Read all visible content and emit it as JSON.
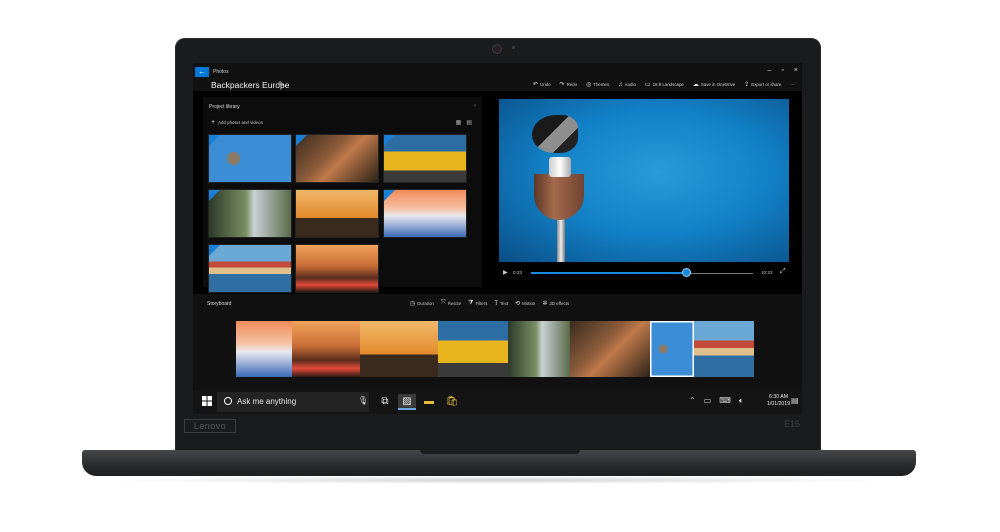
{
  "hardware": {
    "brand": "Lenovo",
    "model": "E15"
  },
  "app": {
    "name": "Photos",
    "project_title": "Backpackers Europe",
    "back_icon": "back-arrow-icon",
    "window_controls": [
      "–",
      "▫",
      "×"
    ]
  },
  "toolbar": {
    "items": [
      {
        "label": "Undo",
        "icon": "↶"
      },
      {
        "label": "Redo",
        "icon": "↷"
      },
      {
        "label": "Themes",
        "icon": "◎"
      },
      {
        "label": "Audio",
        "icon": "♫"
      },
      {
        "label": "16:9 Landscape",
        "icon": "▭"
      },
      {
        "label": "Save in OneDrive",
        "icon": "☁"
      },
      {
        "label": "Export or share",
        "icon": "⇪"
      }
    ],
    "more": "···"
  },
  "library": {
    "title": "Project library",
    "add_label": "Add photos and videos",
    "thumbnails": [
      {
        "scene": "bird",
        "selected": true
      },
      {
        "scene": "ruins",
        "selected": true
      },
      {
        "scene": "van",
        "selected": true
      },
      {
        "scene": "hiker",
        "selected": true
      },
      {
        "scene": "sunset",
        "selected": false
      },
      {
        "scene": "santorini",
        "selected": true
      },
      {
        "scene": "town",
        "selected": true
      },
      {
        "scene": "cliff",
        "selected": false
      }
    ]
  },
  "player": {
    "current_time": "0:23",
    "end_time": "10:23",
    "progress": 0.7
  },
  "storyboard": {
    "title": "Storyboard",
    "tools": [
      {
        "label": "Duration",
        "icon": "◷"
      },
      {
        "label": "Resize",
        "icon": "⤧"
      },
      {
        "label": "Filters",
        "icon": "⧩"
      },
      {
        "label": "Text",
        "icon": "T"
      },
      {
        "label": "Motion",
        "icon": "⟲"
      },
      {
        "label": "3D effects",
        "icon": "✲"
      }
    ]
  },
  "taskbar": {
    "search_placeholder": "Ask me anything",
    "time": "6:30 AM",
    "date": "1/01/2019"
  },
  "colors": {
    "accent": "#0078d7",
    "dark_bg": "#000000"
  }
}
